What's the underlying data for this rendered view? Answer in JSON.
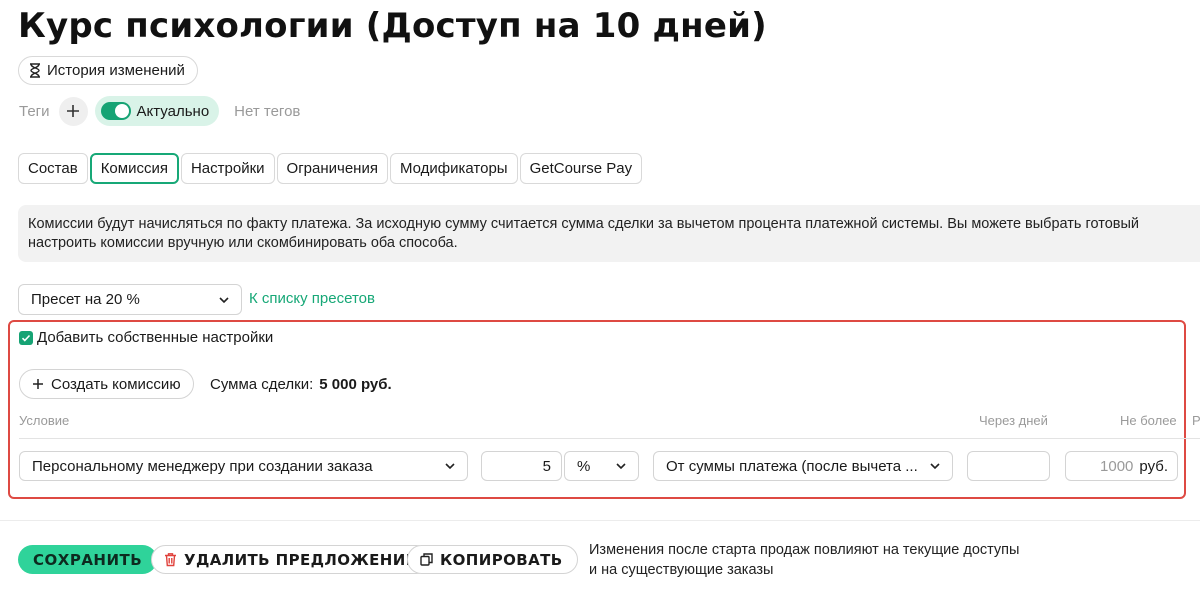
{
  "page": {
    "title": "Курс психологии (Доступ на 10 дней)"
  },
  "history_button": {
    "label": "История изменений",
    "icon": "hourglass-icon"
  },
  "tags": {
    "label": "Теги",
    "add_icon": "plus-icon",
    "status_label": "Актуально",
    "status_on": true,
    "empty_text": "Нет тегов",
    "accent_color": "#16a374"
  },
  "tabs": [
    {
      "label": "Состав",
      "active": false
    },
    {
      "label": "Комиссия",
      "active": true
    },
    {
      "label": "Настройки",
      "active": false
    },
    {
      "label": "Ограничения",
      "active": false
    },
    {
      "label": "Модификаторы",
      "active": false
    },
    {
      "label": "GetCourse Pay",
      "active": false
    }
  ],
  "info": {
    "line1": "Комиссии будут начисляться по факту платежа. За исходную сумму считается сумма сделки за вычетом процента платежной системы. Вы можете выбрать готовый",
    "line2": "настроить комиссии вручную или скомбинировать оба способа."
  },
  "preset": {
    "selected": "Пресет на 20 %",
    "link_label": "К списку пресетов"
  },
  "custom": {
    "checkbox_label": "Добавить собственные настройки",
    "checked": true,
    "create_button": "Создать комиссию",
    "deal_sum_label": "Сумма сделки:",
    "deal_sum_value": "5 000 руб."
  },
  "table": {
    "headers": {
      "condition": "Условие",
      "days": "Через дней",
      "max": "Не более",
      "cut": "Р"
    },
    "row": {
      "condition": "Персональному менеджеру при создании заказа",
      "amount": "5",
      "unit": "%",
      "base": "От суммы платежа (после вычета ...",
      "days": "",
      "max_placeholder": "1000",
      "max_suffix": "руб."
    }
  },
  "footer": {
    "save": "СОХРАНИТЬ",
    "delete": "УДАЛИТЬ ПРЕДЛОЖЕНИЕ",
    "copy": "КОПИРОВАТЬ",
    "notice_line1": "Изменения после старта продаж повлияют на текущие доступы",
    "notice_line2": "и на существующие заказы",
    "save_color": "#2fd39a",
    "delete_icon_color": "#e0413b"
  }
}
